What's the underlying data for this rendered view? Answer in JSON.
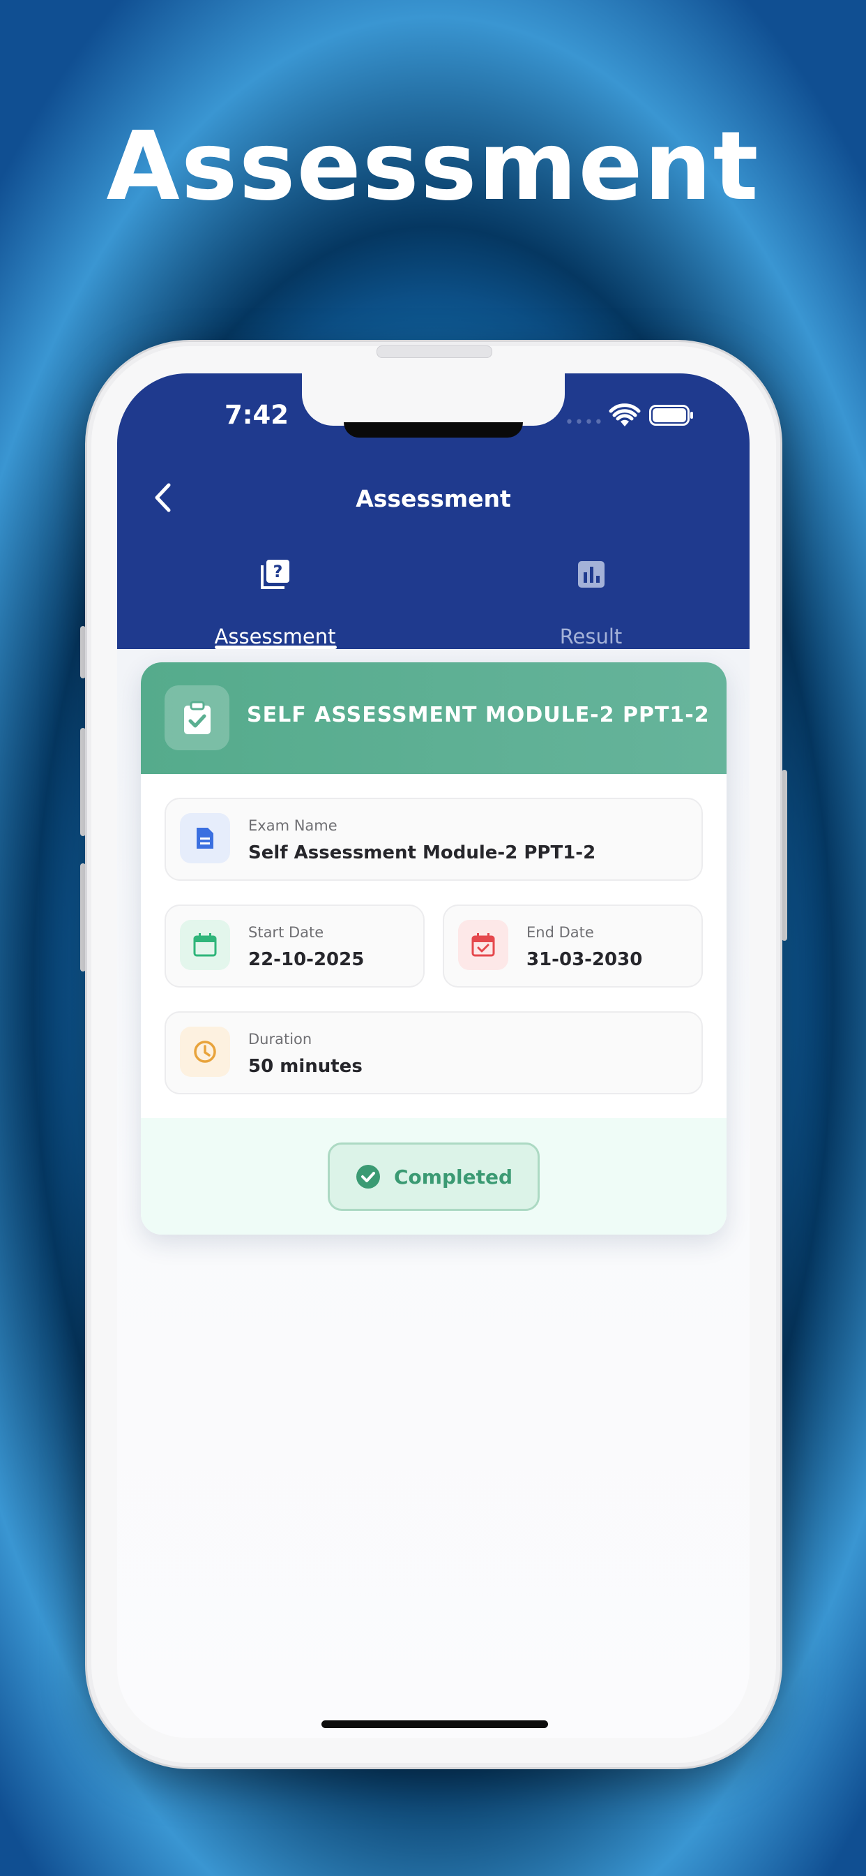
{
  "marketing": {
    "title": "Assessment"
  },
  "status_bar": {
    "time": "7:42",
    "signal": "••••"
  },
  "nav": {
    "title": "Assessment"
  },
  "tabs": [
    {
      "label": "Assessment",
      "icon": "quiz-icon",
      "active": true
    },
    {
      "label": "Result",
      "icon": "bar-chart-icon",
      "active": false
    }
  ],
  "card": {
    "title": "SELF ASSESSMENT MODULE-2 PPT1-2",
    "exam_name": {
      "label": "Exam Name",
      "value": "Self Assessment Module-2 PPT1-2"
    },
    "start_date": {
      "label": "Start Date",
      "value": "22-10-2025"
    },
    "end_date": {
      "label": "End Date",
      "value": "31-03-2030"
    },
    "duration": {
      "label": "Duration",
      "value": "50 minutes"
    },
    "status": "Completed"
  },
  "colors": {
    "header": "#1f3a8e",
    "card_header": "#5aaf91",
    "completed": "#3b9a73",
    "start_date_icon": "#2fb57a",
    "end_date_icon": "#e5484d",
    "duration_icon": "#e8a33b",
    "exam_icon": "#3a6fe0"
  }
}
